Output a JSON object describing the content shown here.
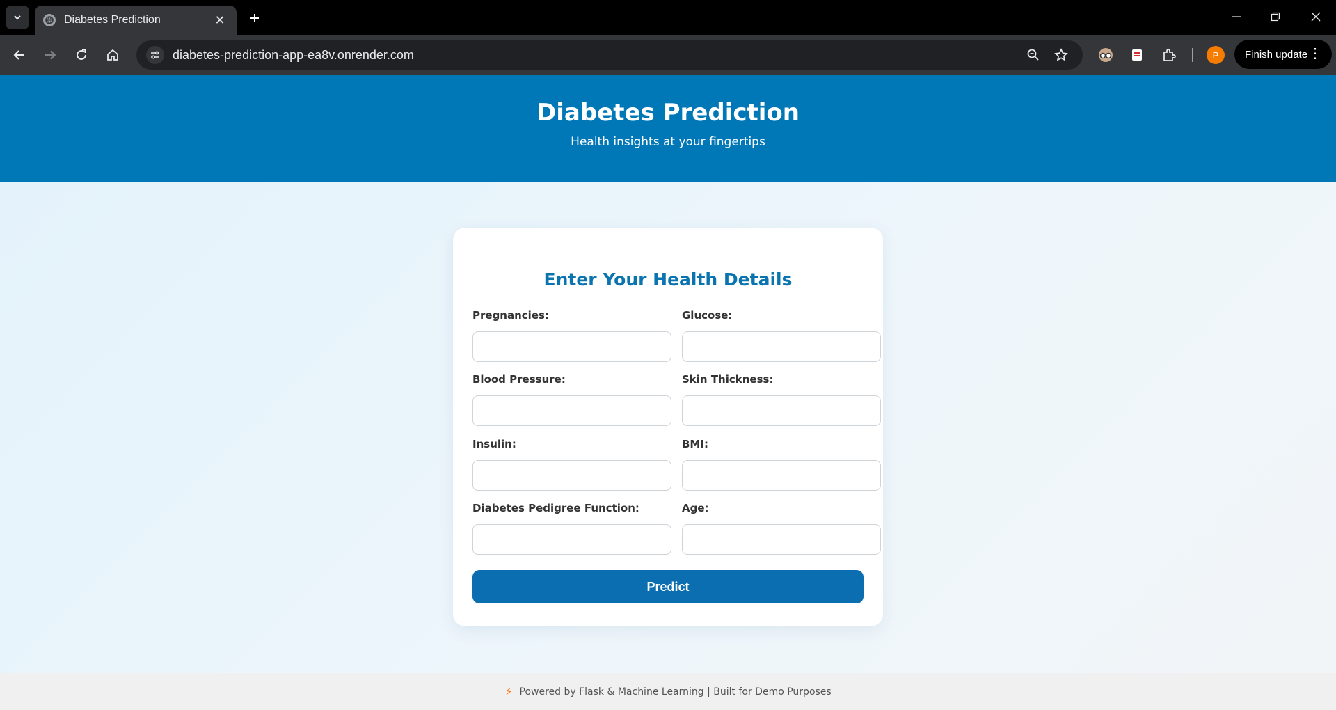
{
  "browser": {
    "tab_title": "Diabetes Prediction",
    "url": "diabetes-prediction-app-ea8v.onrender.com",
    "profile_initial": "P",
    "finish_update_label": "Finish update"
  },
  "header": {
    "title": "Diabetes Prediction",
    "subtitle": "Health insights at your fingertips"
  },
  "form": {
    "heading": "Enter Your Health Details",
    "fields": [
      {
        "label": "Pregnancies:",
        "value": ""
      },
      {
        "label": "Glucose:",
        "value": ""
      },
      {
        "label": "Blood Pressure:",
        "value": ""
      },
      {
        "label": "Skin Thickness:",
        "value": ""
      },
      {
        "label": "Insulin:",
        "value": ""
      },
      {
        "label": "BMI:",
        "value": ""
      },
      {
        "label": "Diabetes Pedigree Function:",
        "value": ""
      },
      {
        "label": "Age:",
        "value": ""
      }
    ],
    "submit_label": "Predict"
  },
  "footer": {
    "text": "Powered by Flask & Machine Learning | Built for Demo Purposes"
  },
  "colors": {
    "primary": "#0077b6",
    "heading": "#0a74b0",
    "button": "#0a6eb0",
    "footer_icon": "#ff6b00"
  }
}
